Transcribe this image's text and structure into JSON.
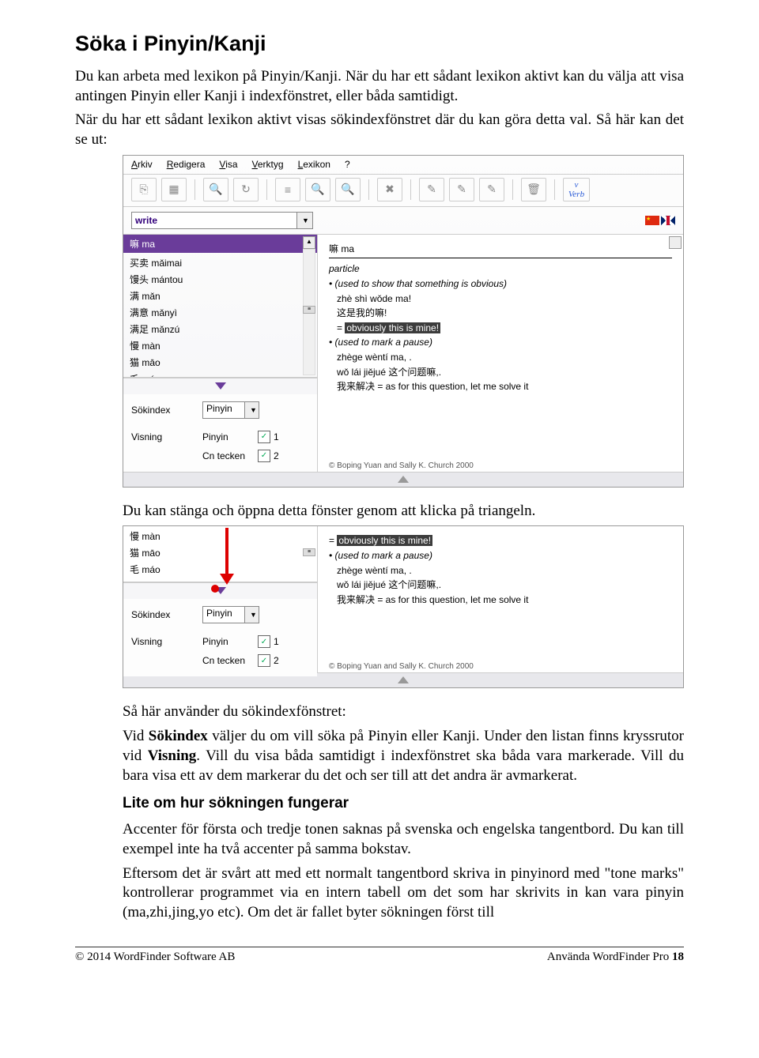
{
  "heading": "Söka i Pinyin/Kanji",
  "para1": "Du kan arbeta med lexikon på Pinyin/Kanji. När du har ett sådant lexikon aktivt kan du välja att visa antingen Pinyin eller Kanji i indexfönstret, eller båda samtidigt.",
  "para2": "När du har ett sådant lexikon aktivt visas sökindexfönstret där du kan göra detta val. Så här kan det se ut:",
  "para3": "Du kan stänga och öppna detta fönster genom att klicka på triangeln.",
  "para4a": "Så här använder du sökindexfönstret:",
  "para4b_1": "Vid ",
  "para4b_bold1": "Sökindex",
  "para4b_2": " väljer du om vill söka på Pinyin eller Kanji. Under den listan finns kryssrutor vid ",
  "para4b_bold2": "Visning",
  "para4b_3": ". Vill du visa båda samtidigt i indexfönstret ska båda vara markerade. Vill du bara visa ett av dem markerar du det och ser till att det andra är avmarkerat.",
  "subheading": "Lite om hur sökningen fungerar",
  "para5": "Accenter för första och tredje tonen saknas på svenska och engelska tangentbord. Du kan till exempel inte ha två accenter på samma bokstav.",
  "para6": "Eftersom det är svårt att med ett normalt tangentbord skriva in pinyinord med \"tone marks\" kontrollerar programmet via en intern tabell om det som har skrivits in kan vara pinyin (ma,zhi,jing,yo etc). Om det är fallet byter sökningen först till",
  "menu": {
    "arkiv": "Arkiv",
    "redigera": "Redigera",
    "visa": "Visa",
    "verktyg": "Verktyg",
    "lexikon": "Lexikon",
    "help": "?"
  },
  "verb_label": "Verb",
  "search_value": "write",
  "wordlist_header": "嘛 ma",
  "wordlist": [
    "买卖 mǎimai",
    "馒头 mántou",
    "满 mǎn",
    "满意 mǎnyì",
    "满足 mǎnzú",
    "慢 màn",
    "猫 māo",
    "毛 máo"
  ],
  "wordlist2": [
    "慢 màn",
    "猫 māo",
    "毛 máo"
  ],
  "entry": {
    "hw": "嘛 ma",
    "pos": "particle",
    "sense1": "(used to show that something is obvious)",
    "ex1py": "zhè shì wǒde ma!",
    "ex1cn": "这是我的嘛!",
    "ex1tr": "obviously this is mine!",
    "sense2": "(used to mark a pause)",
    "ex2py": "zhège wèntí ma, .",
    "ex2py2": "wǒ lái jiějué 这个问题嘛,.",
    "ex2line": "我来解决 = as for this question, let me solve it",
    "copyright": "© Boping Yuan and Sally K. Church 2000"
  },
  "settings": {
    "sokindex": "Sökindex",
    "visning": "Visning",
    "pinyin": "Pinyin",
    "cntecken": "Cn tecken",
    "n1": "1",
    "n2": "2"
  },
  "footer": {
    "left": "© 2014 WordFinder Software AB",
    "right_text": "Använda WordFinder Pro ",
    "right_page": "18"
  }
}
